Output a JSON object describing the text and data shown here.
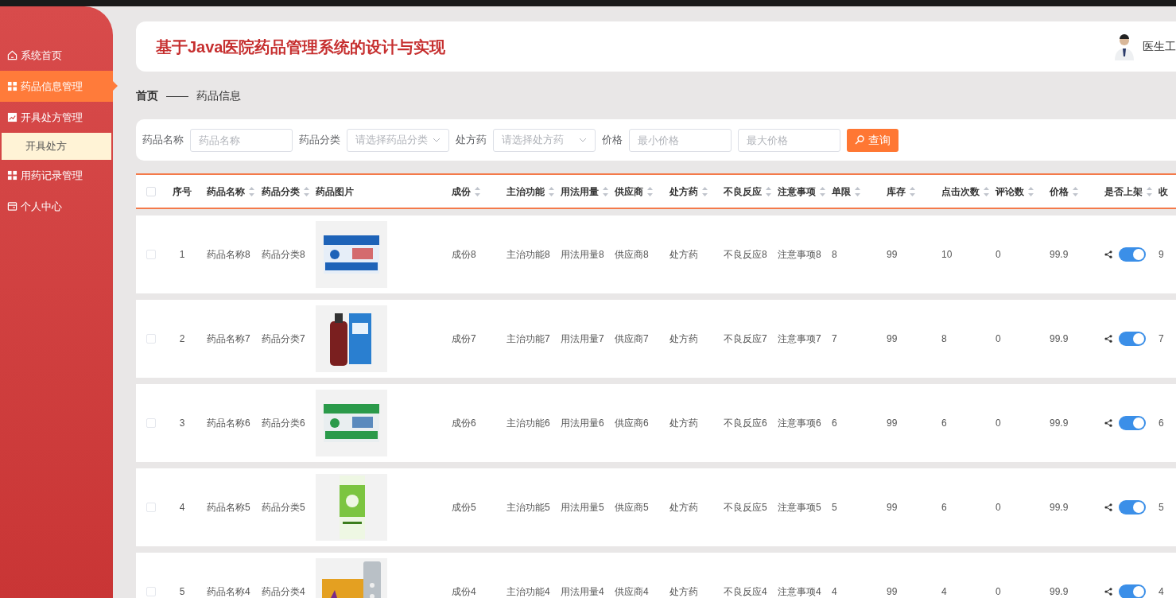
{
  "sidebar": {
    "items": [
      {
        "label": "系统首页",
        "kind": "home",
        "selected": false
      },
      {
        "label": "药品信息管理",
        "kind": "grid",
        "selected": true
      },
      {
        "label": "开具处方管理",
        "kind": "chart",
        "selected": false,
        "children": [
          {
            "label": "开具处方",
            "selected": true
          }
        ]
      },
      {
        "label": "用药记录管理",
        "kind": "grid",
        "selected": false
      },
      {
        "label": "个人中心",
        "kind": "wallet",
        "selected": false
      }
    ]
  },
  "header": {
    "title": "基于Java医院药品管理系统的设计与实现",
    "user": "医生工"
  },
  "breadcrumb": [
    "首页",
    "——",
    "药品信息"
  ],
  "search": {
    "fields": [
      {
        "label": "药品名称",
        "placeholder": "药品名称",
        "kind": "input"
      },
      {
        "label": "药品分类",
        "placeholder": "请选择药品分类",
        "kind": "select"
      },
      {
        "label": "处方药",
        "placeholder": "请选择处方药",
        "kind": "select"
      },
      {
        "label": "价格",
        "placeholder": "最小价格",
        "kind": "input"
      },
      {
        "placeholder": "最大价格",
        "kind": "input"
      }
    ],
    "button": "查询"
  },
  "table": {
    "all_checked": false,
    "columns": [
      {
        "label": "序号",
        "sortable": false
      },
      {
        "label": "药品名称",
        "sortable": true
      },
      {
        "label": "药品分类",
        "sortable": true
      },
      {
        "label": "药品图片",
        "sortable": false
      },
      {
        "label": "成份",
        "sortable": true
      },
      {
        "label": "主治功能",
        "sortable": true
      },
      {
        "label": "用法用量",
        "sortable": true
      },
      {
        "label": "供应商",
        "sortable": true
      },
      {
        "label": "处方药",
        "sortable": true
      },
      {
        "label": "不良反应",
        "sortable": true
      },
      {
        "label": "注意事项",
        "sortable": true
      },
      {
        "label": "单限",
        "sortable": true
      },
      {
        "label": "库存",
        "sortable": true
      },
      {
        "label": "点击次数",
        "sortable": true
      },
      {
        "label": "评论数",
        "sortable": true
      },
      {
        "label": "价格",
        "sortable": true
      },
      {
        "label": "是否上架",
        "sortable": true
      },
      {
        "label": "收",
        "sortable": false
      }
    ],
    "rows": [
      {
        "checked": false,
        "on": true,
        "cells": [
          "1",
          "药品名称8",
          "药品分类8",
          "",
          "成份8",
          "主治功能8",
          "用法用量8",
          "供应商8",
          "处方药",
          "不良反应8",
          "注意事项8",
          "8",
          "99",
          "10",
          "0",
          "99.9",
          "",
          "9"
        ]
      },
      {
        "checked": false,
        "on": true,
        "cells": [
          "2",
          "药品名称7",
          "药品分类7",
          "",
          "成份7",
          "主治功能7",
          "用法用量7",
          "供应商7",
          "处方药",
          "不良反应7",
          "注意事项7",
          "7",
          "99",
          "8",
          "0",
          "99.9",
          "",
          "7"
        ]
      },
      {
        "checked": false,
        "on": true,
        "cells": [
          "3",
          "药品名称6",
          "药品分类6",
          "",
          "成份6",
          "主治功能6",
          "用法用量6",
          "供应商6",
          "处方药",
          "不良反应6",
          "注意事项6",
          "6",
          "99",
          "6",
          "0",
          "99.9",
          "",
          "6"
        ]
      },
      {
        "checked": false,
        "on": true,
        "cells": [
          "4",
          "药品名称5",
          "药品分类5",
          "",
          "成份5",
          "主治功能5",
          "用法用量5",
          "供应商5",
          "处方药",
          "不良反应5",
          "注意事项5",
          "5",
          "99",
          "6",
          "0",
          "99.9",
          "",
          "5"
        ]
      },
      {
        "checked": false,
        "on": true,
        "cells": [
          "5",
          "药品名称4",
          "药品分类4",
          "",
          "成份4",
          "主治功能4",
          "用法用量4",
          "供应商4",
          "处方药",
          "不良反应4",
          "注意事项4",
          "4",
          "99",
          "4",
          "0",
          "99.9",
          "",
          "4"
        ]
      }
    ]
  }
}
